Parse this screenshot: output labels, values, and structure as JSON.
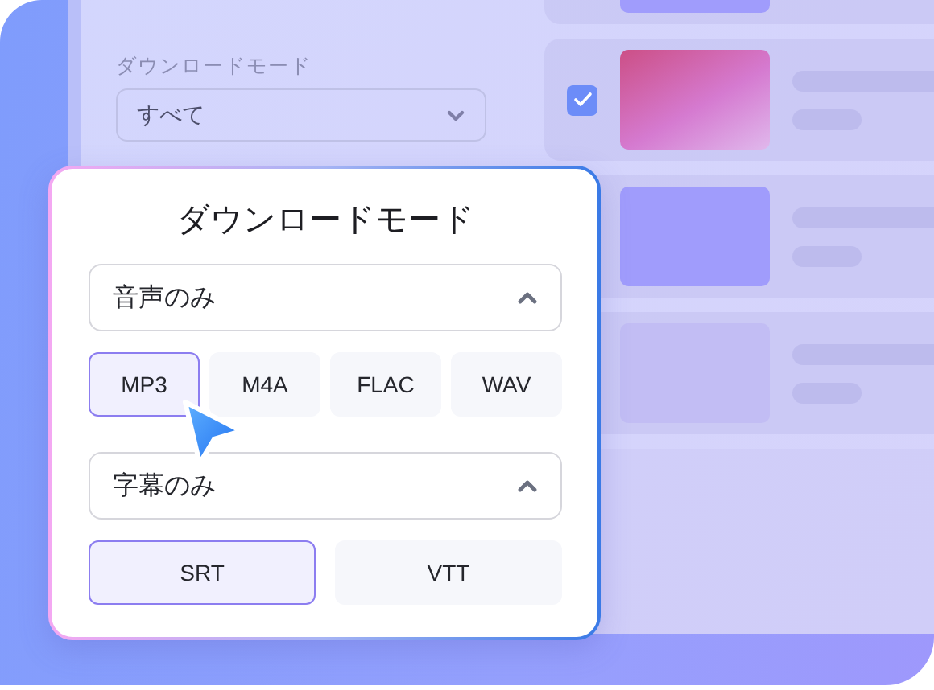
{
  "background": {
    "label": "ダウンロードモード",
    "select": {
      "value": "すべて",
      "expanded": false
    },
    "rows": [
      {
        "color": "#a09cfc"
      },
      {
        "color": "#cc4f86",
        "checked": true
      },
      {
        "color": "#a09cfc"
      },
      {
        "color": "#c2bdf4"
      }
    ]
  },
  "popup": {
    "title": "ダウンロードモード",
    "groups": [
      {
        "select": {
          "value": "音声のみ",
          "expanded": true
        },
        "options": [
          {
            "label": "MP3",
            "selected": true
          },
          {
            "label": "M4A",
            "selected": false
          },
          {
            "label": "FLAC",
            "selected": false
          },
          {
            "label": "WAV",
            "selected": false
          }
        ]
      },
      {
        "select": {
          "value": "字幕のみ",
          "expanded": true
        },
        "options": [
          {
            "label": "SRT",
            "selected": true
          },
          {
            "label": "VTT",
            "selected": false
          }
        ]
      }
    ]
  }
}
